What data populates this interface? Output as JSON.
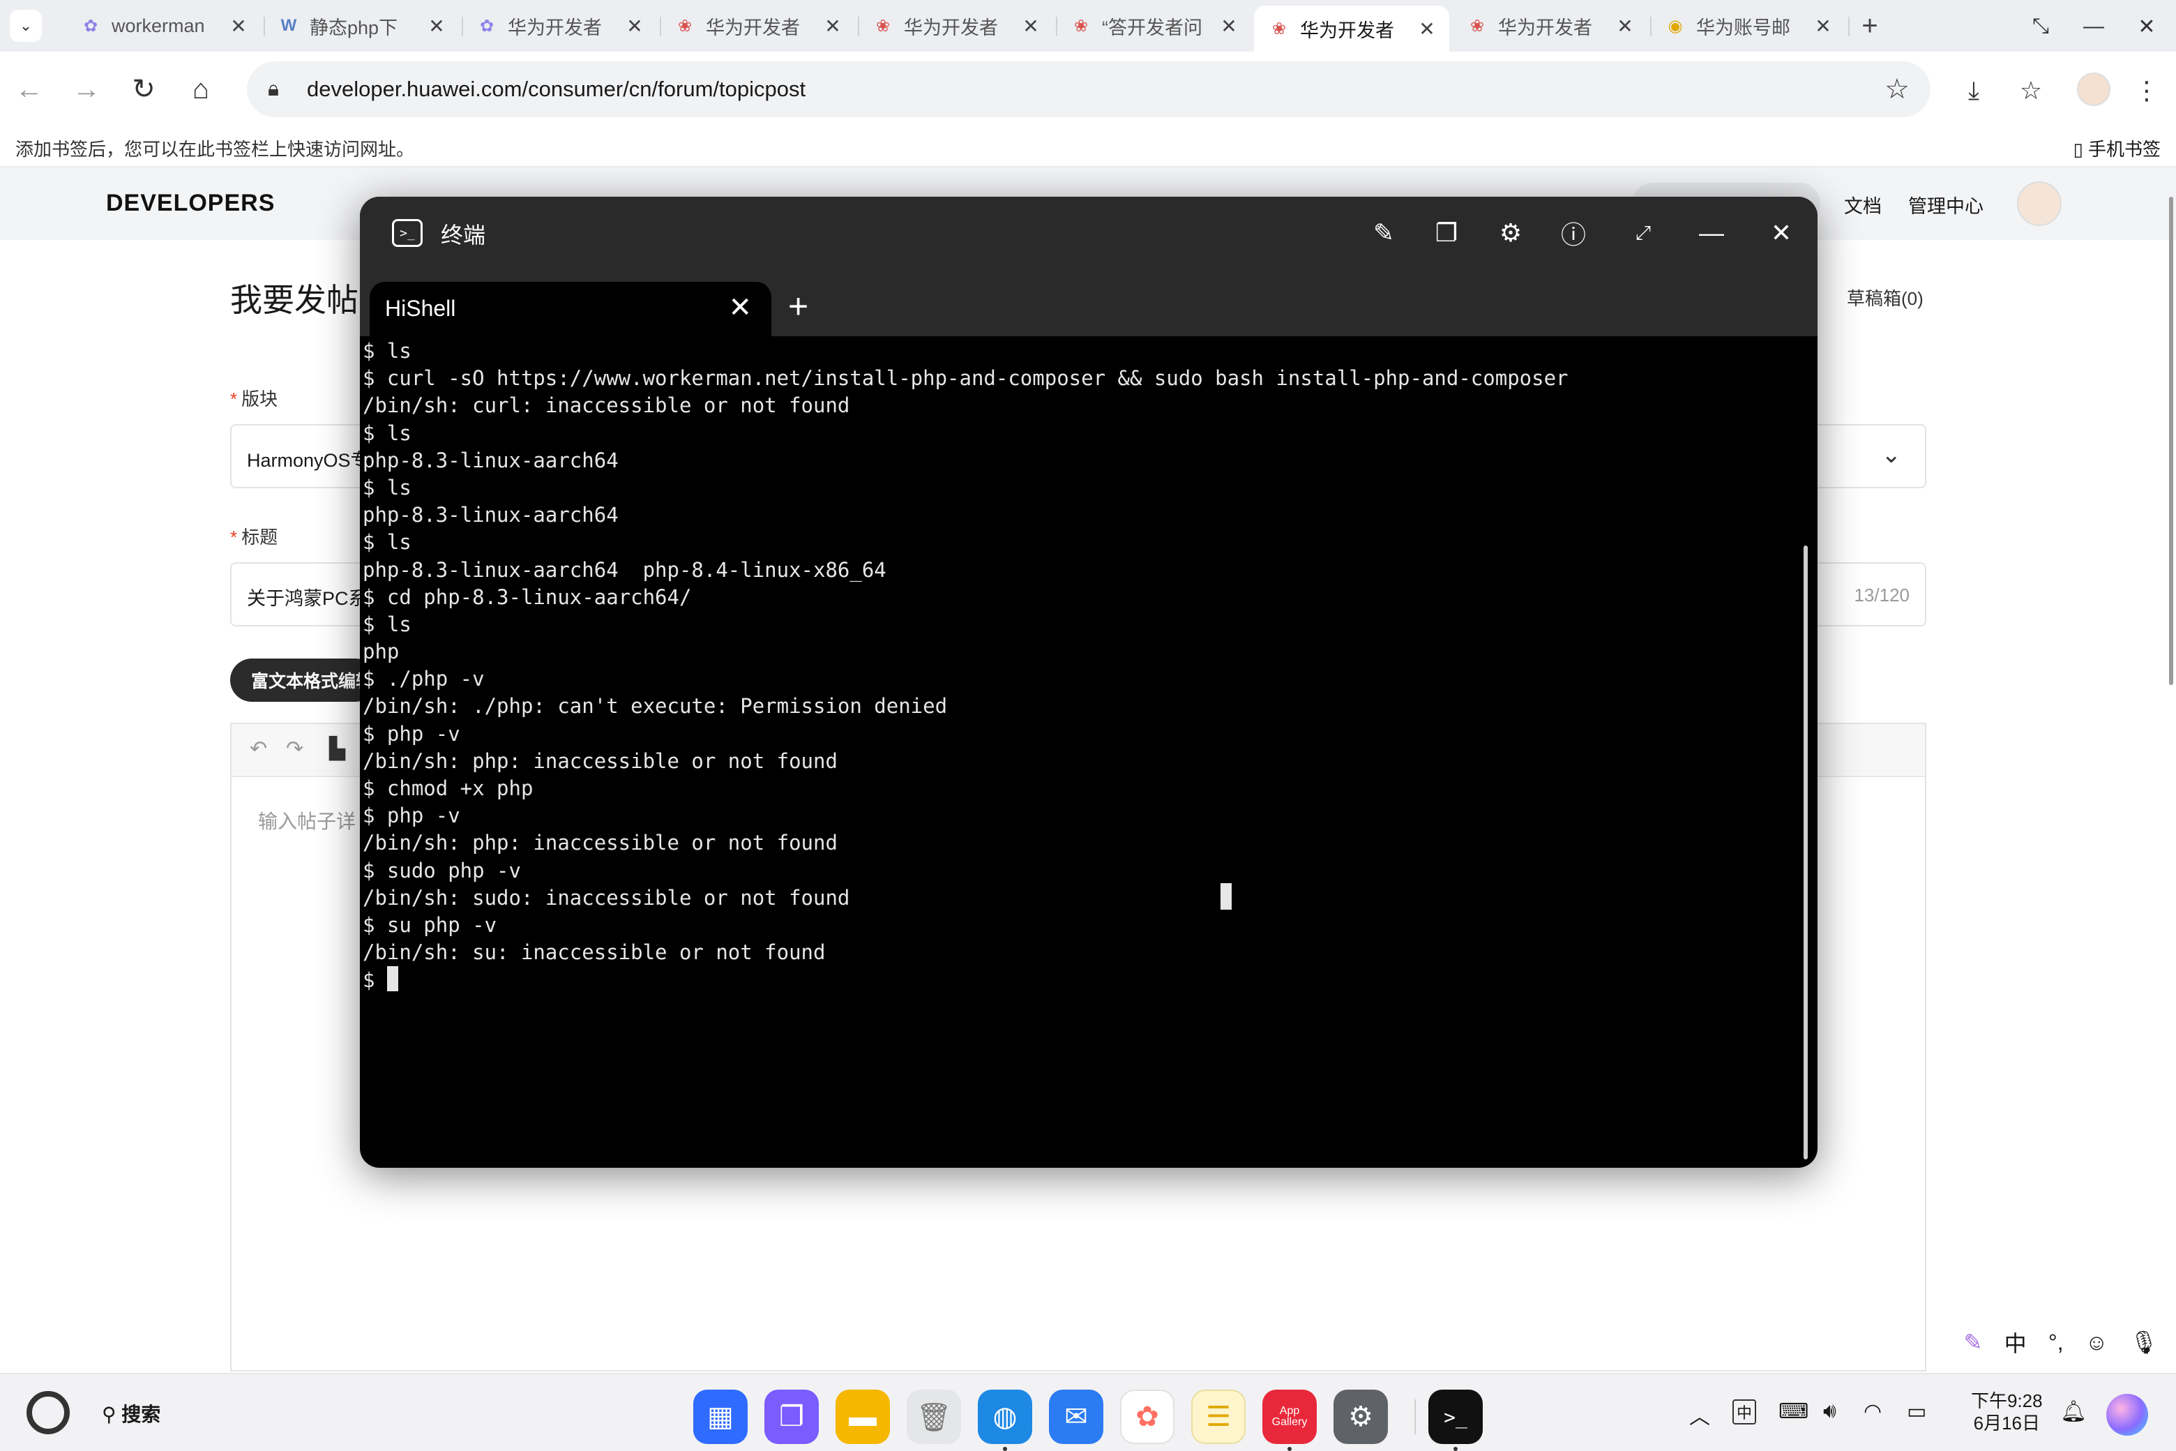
{
  "browser": {
    "tabs": [
      {
        "label": "workerman",
        "icon": "paw-icon",
        "active": false
      },
      {
        "label": "静态php下",
        "icon": "w-logo-icon",
        "active": false
      },
      {
        "label": "华为开发者",
        "icon": "paw-icon",
        "active": false
      },
      {
        "label": "华为开发者",
        "icon": "huawei-icon",
        "active": false
      },
      {
        "label": "华为开发者",
        "icon": "huawei-icon",
        "active": false
      },
      {
        "label": "“答开发者问",
        "icon": "huawei-icon",
        "active": false
      },
      {
        "label": "华为开发者",
        "icon": "huawei-icon",
        "active": true
      },
      {
        "label": "华为开发者",
        "icon": "huawei-icon",
        "active": false
      },
      {
        "label": "华为账号邮",
        "icon": "chrome-like-icon",
        "active": false
      }
    ],
    "url": "developer.huawei.com/consumer/cn/forum/topicpost",
    "bookmark_hint": "添加书签后，您可以在此书签栏上快速访问网址。",
    "mobile_bookmarks": "手机书签"
  },
  "site": {
    "logo": "DEVELOPERS",
    "nav_right": [
      "文档",
      "管理中心"
    ],
    "page_title": "我要发帖",
    "drafts": "草稿箱(0)",
    "section_label": "版块",
    "section_value": "HarmonyOS专",
    "title_label": "标题",
    "title_value": "关于鸿蒙PC系",
    "title_count": "13/120",
    "rich_text_tab": "富文本格式编辑",
    "editor_placeholder": "输入帖子详"
  },
  "terminal": {
    "window_title": "终端",
    "tab_name": "HiShell",
    "lines": [
      "$ ls",
      "$ curl -sO https://www.workerman.net/install-php-and-composer && sudo bash install-php-and-composer",
      "/bin/sh: curl: inaccessible or not found",
      "$ ls",
      "php-8.3-linux-aarch64",
      "$ ls",
      "php-8.3-linux-aarch64",
      "$ ls",
      "php-8.3-linux-aarch64  php-8.4-linux-x86_64",
      "$ cd php-8.3-linux-aarch64/",
      "$ ls",
      "php",
      "$ ./php -v",
      "/bin/sh: ./php: can't execute: Permission denied",
      "$ php -v",
      "/bin/sh: php: inaccessible or not found",
      "$ chmod +x php",
      "$ php -v",
      "/bin/sh: php: inaccessible or not found",
      "$ sudo php -v",
      "/bin/sh: sudo: inaccessible or not found",
      "$ su php -v",
      "/bin/sh: su: inaccessible or not found"
    ],
    "prompt": "$ "
  },
  "ime": {
    "mode": "中",
    "punct": "°,"
  },
  "taskbar": {
    "search_label": "搜索",
    "apps": [
      {
        "name": "app-center",
        "color": "#2f6bff"
      },
      {
        "name": "multi-window",
        "color": "#7a5cff"
      },
      {
        "name": "files",
        "color": "#f5b700"
      },
      {
        "name": "trash",
        "color": "#9aa0a6"
      },
      {
        "name": "browser",
        "color": "#1e88e5"
      },
      {
        "name": "mail",
        "color": "#2b7bf3"
      },
      {
        "name": "gallery",
        "color": "#ff6f61"
      },
      {
        "name": "notes",
        "color": "#f7c948"
      },
      {
        "name": "app-gallery",
        "color": "#e8283a",
        "label": "App\nGallery"
      },
      {
        "name": "settings",
        "color": "#5f6368"
      },
      {
        "name": "terminal",
        "color": "#111111"
      }
    ],
    "ime_indicator": "中",
    "clock_time": "下午9:28",
    "clock_date": "6月16日"
  }
}
